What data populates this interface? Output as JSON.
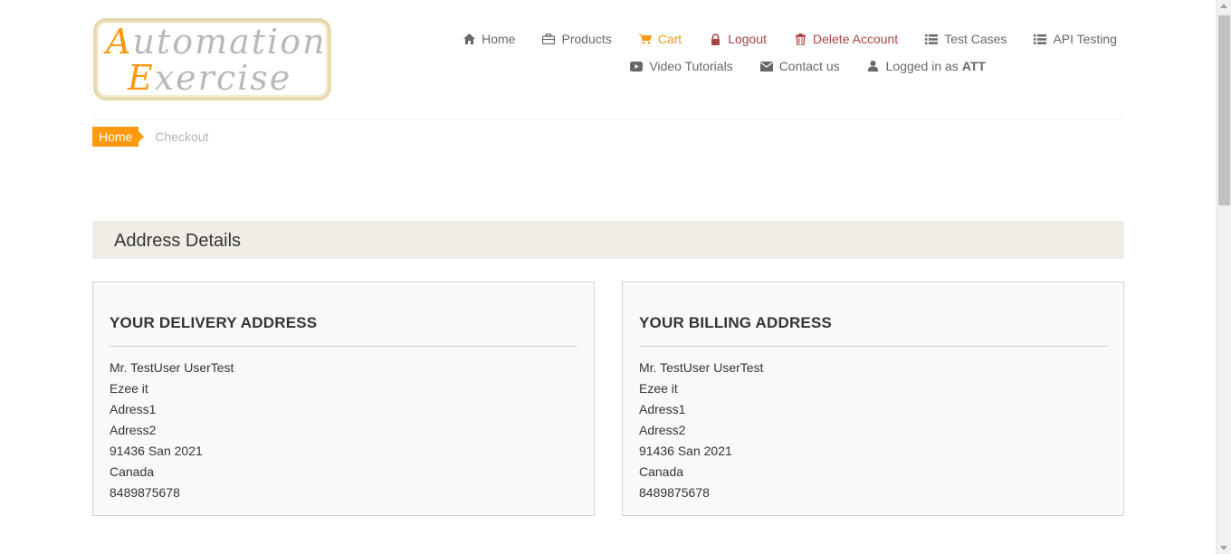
{
  "logo": {
    "line1_cap": "A",
    "line1_rest": "utomation",
    "line2_cap": "E",
    "line2_rest": "xercise"
  },
  "nav": {
    "row1": [
      {
        "label": "Home",
        "icon": "home-icon"
      },
      {
        "label": "Products",
        "icon": "briefcase-icon"
      },
      {
        "label": "Cart",
        "icon": "shopping-cart-icon"
      },
      {
        "label": "Logout",
        "icon": "lock-icon"
      },
      {
        "label": "Delete Account",
        "icon": "trash-icon"
      },
      {
        "label": "Test Cases",
        "icon": "list-icon"
      },
      {
        "label": "API Testing",
        "icon": "list-icon"
      }
    ],
    "row2": [
      {
        "label": "Video Tutorials",
        "icon": "youtube-play-icon"
      },
      {
        "label": "Contact us",
        "icon": "envelope-icon"
      },
      {
        "label": "Logged in as",
        "icon": "user-icon",
        "username": "ATT"
      }
    ]
  },
  "breadcrumb": {
    "home": "Home",
    "current": "Checkout"
  },
  "address_section": {
    "heading": "Address Details"
  },
  "delivery": {
    "title": "YOUR DELIVERY ADDRESS",
    "lines": [
      "Mr. TestUser UserTest",
      "Ezee it",
      "Adress1",
      "Adress2",
      "91436 San 2021",
      "Canada",
      "8489875678"
    ]
  },
  "billing": {
    "title": "YOUR BILLING ADDRESS",
    "lines": [
      "Mr. TestUser UserTest",
      "Ezee it",
      "Adress1",
      "Adress2",
      "91436 San 2021",
      "Canada",
      "8489875678"
    ]
  },
  "colors": {
    "accent": "#fe980f",
    "danger": "#a94442",
    "text": "#696763",
    "heading_bg": "#efede6"
  }
}
